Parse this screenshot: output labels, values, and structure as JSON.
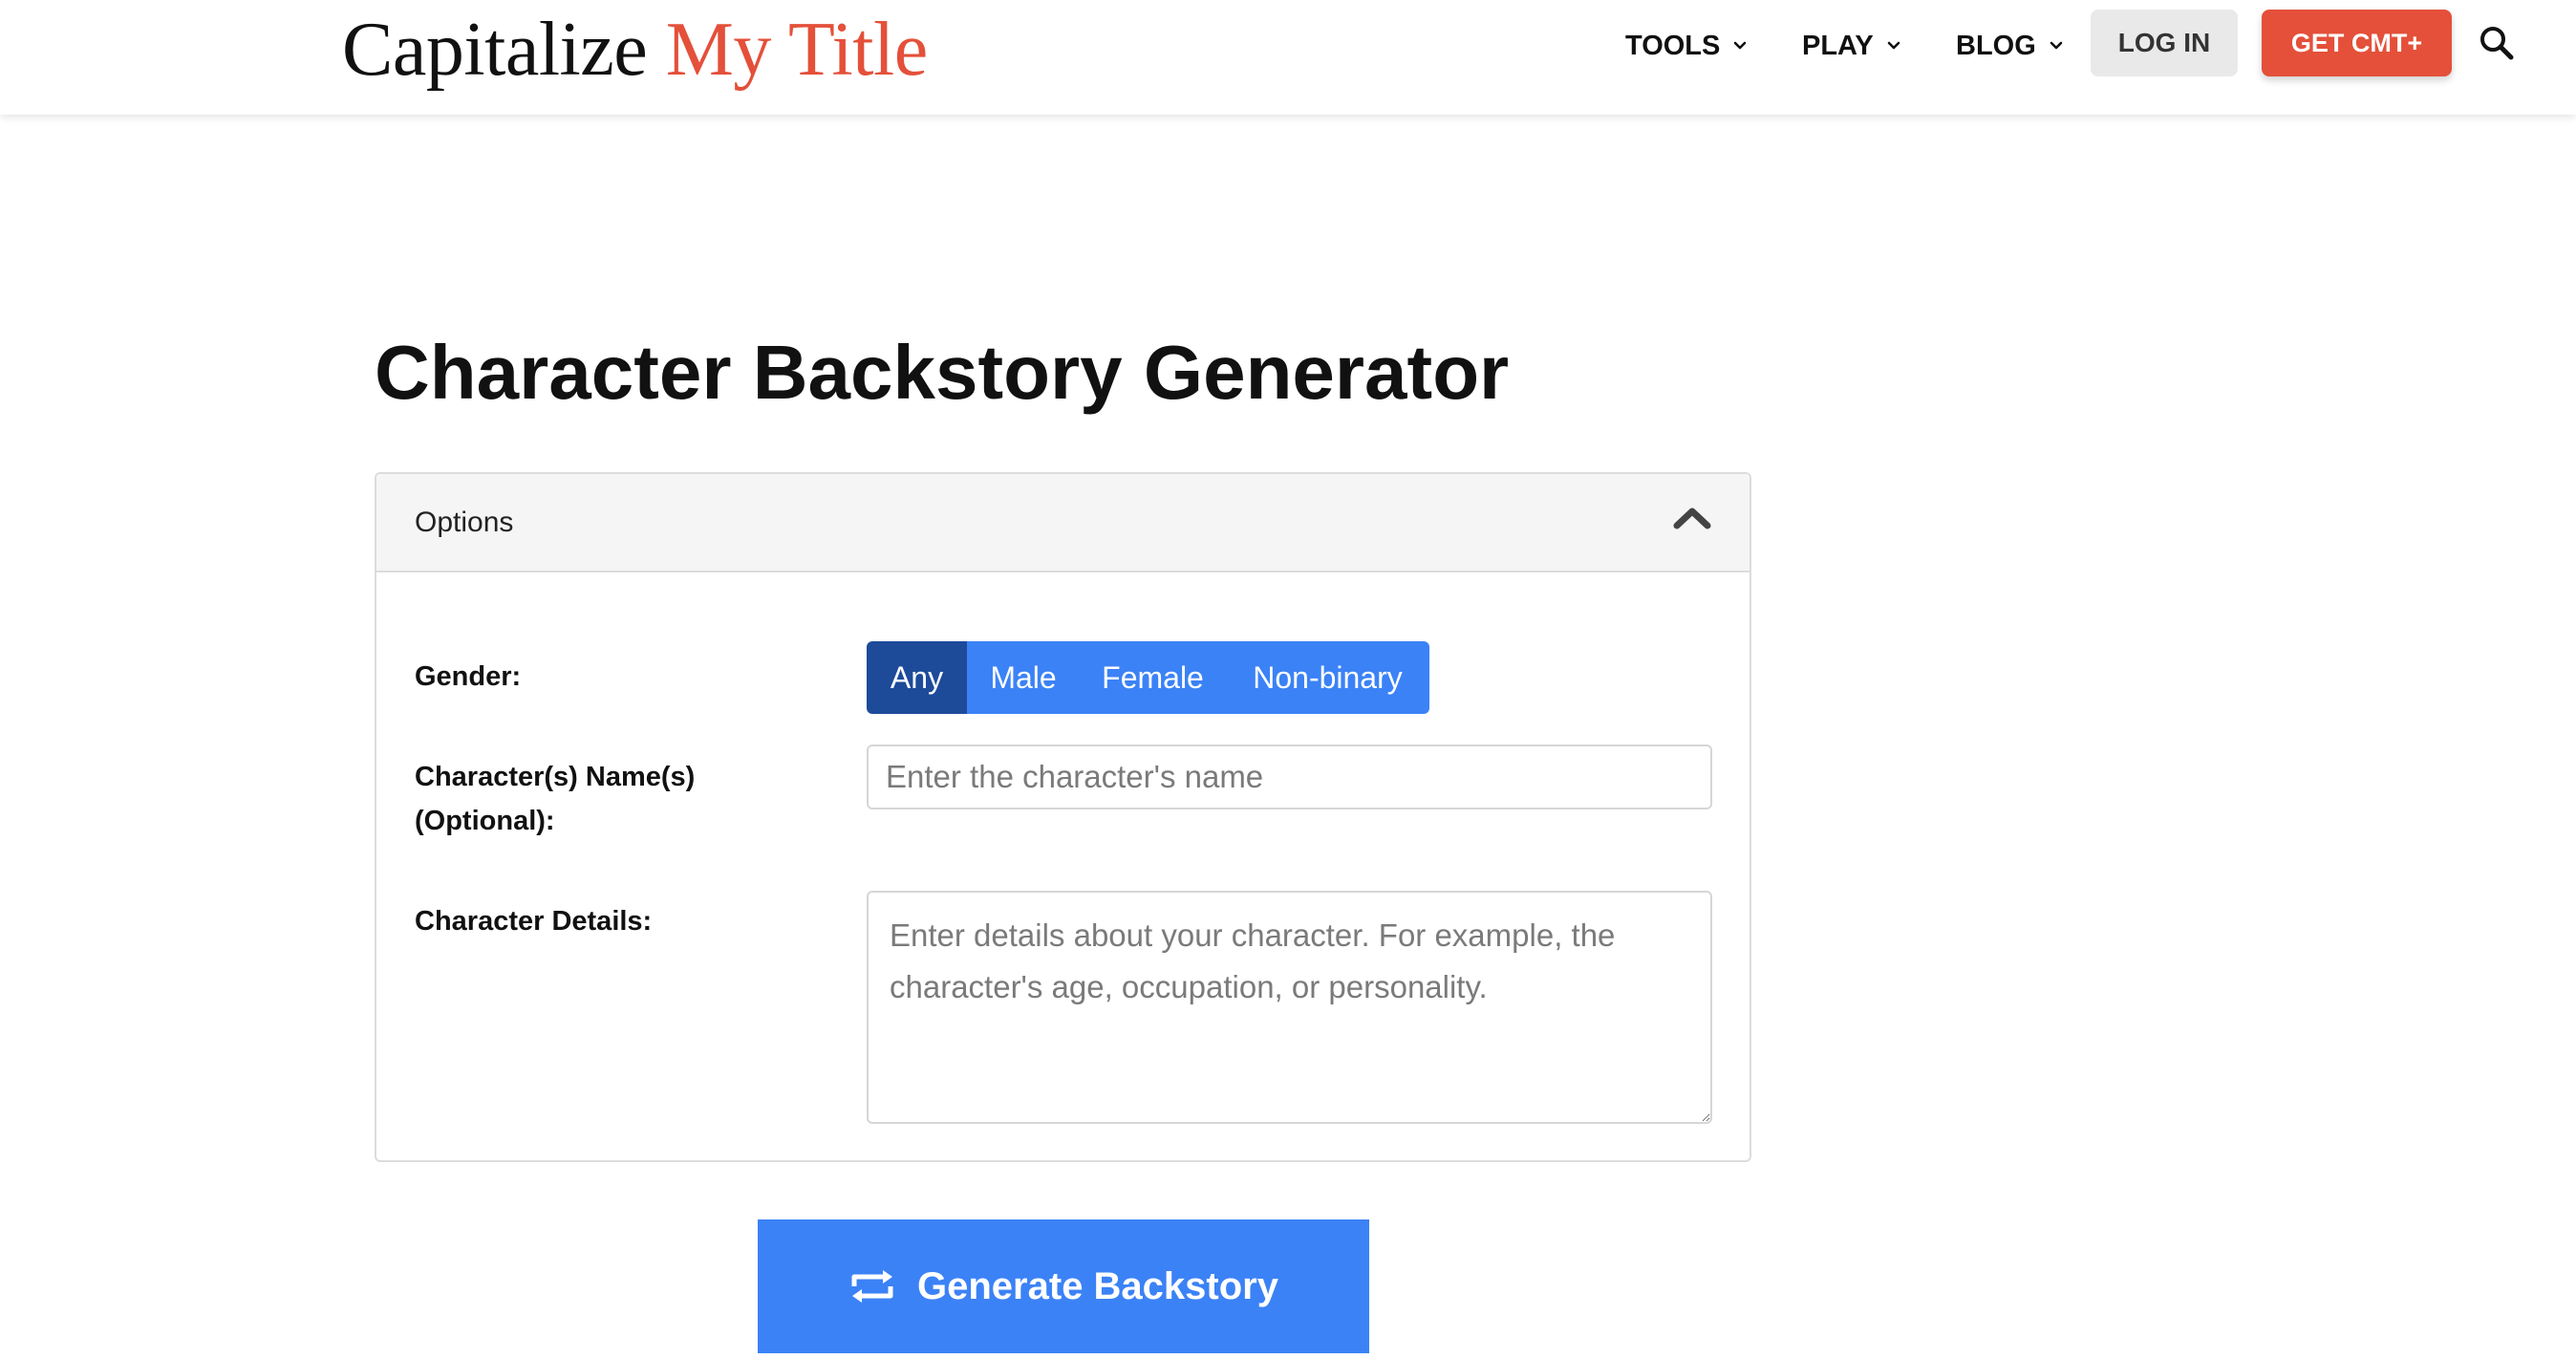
{
  "header": {
    "logo": {
      "part1": "Capitalize",
      "part2": "My Title"
    },
    "nav": [
      {
        "label": "TOOLS",
        "icon": "chevron-down-icon"
      },
      {
        "label": "PLAY",
        "icon": "chevron-down-icon"
      },
      {
        "label": "BLOG",
        "icon": "chevron-down-icon"
      }
    ],
    "login_label": "LOG IN",
    "cta_label": "GET CMT+",
    "search_icon": "search-icon"
  },
  "main": {
    "title": "Character Backstory Generator",
    "options": {
      "header_label": "Options",
      "toggle_icon": "chevron-up-icon",
      "gender": {
        "label": "Gender:",
        "options": [
          "Any",
          "Male",
          "Female",
          "Non-binary"
        ],
        "selected": "Any"
      },
      "name": {
        "label_line1": "Character(s) Name(s)",
        "label_line2": "(Optional):",
        "value": "",
        "placeholder": "Enter the character's name"
      },
      "details": {
        "label": "Character Details:",
        "value": "",
        "placeholder": "Enter details about your character. For example, the character's age, occupation, or personality."
      }
    },
    "generate": {
      "label": "Generate Backstory",
      "icon": "repeat-icon"
    }
  },
  "colors": {
    "brand_red": "#e4503a",
    "primary_blue": "#3b82f6",
    "selected_blue": "#1d4b9a"
  }
}
